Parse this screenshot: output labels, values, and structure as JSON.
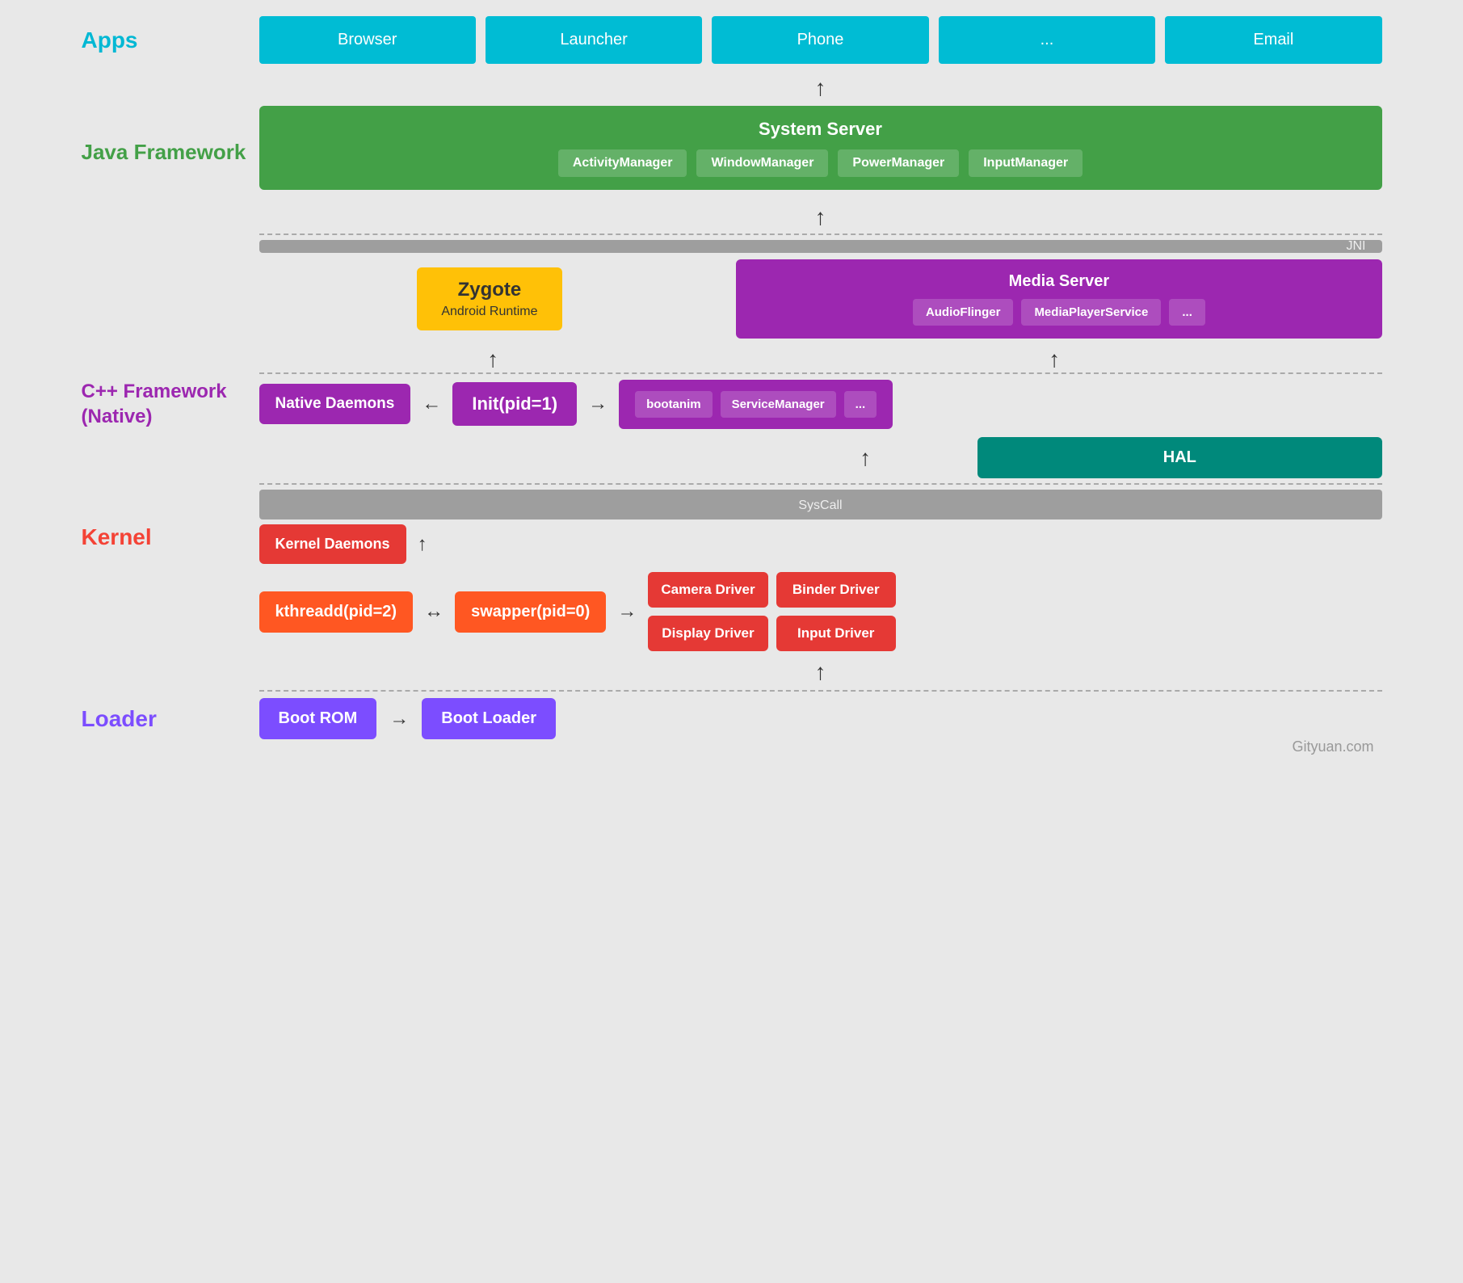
{
  "layers": {
    "apps": {
      "label": "Apps",
      "items": [
        "Browser",
        "Launcher",
        "Phone",
        "...",
        "Email"
      ]
    },
    "java_framework": {
      "label": "Java Framework",
      "system_server": {
        "title": "System Server",
        "items": [
          "ActivityManager",
          "WindowManager",
          "PowerManager",
          "InputManager"
        ]
      }
    },
    "jni_bar": "JNI",
    "zygote": {
      "title": "Zygote",
      "subtitle": "Android Runtime"
    },
    "cpp_framework": {
      "label": "C++ Framework\n(Native)",
      "media_server": {
        "title": "Media Server",
        "items": [
          "AudioFlinger",
          "MediaPlayerService",
          "..."
        ]
      },
      "init": "Init(pid=1)",
      "native_daemons": "Native Daemons",
      "services": [
        "bootanim",
        "ServiceManager",
        "..."
      ],
      "hal": "HAL"
    },
    "syscall_bar": "SysCall",
    "kernel": {
      "label": "Kernel",
      "kernel_daemons": "Kernel Daemons",
      "kthreadd": "kthreadd(pid=2)",
      "swapper": "swapper(pid=0)",
      "drivers": [
        "Camera Driver",
        "Binder Driver",
        "Display Driver",
        "Input Driver"
      ]
    },
    "loader": {
      "label": "Loader",
      "boot_rom": "Boot ROM",
      "boot_loader": "Boot Loader"
    }
  },
  "watermark": "Gityuan.com",
  "arrows": {
    "left": "←",
    "right": "→",
    "up": "↑",
    "both": "↔"
  }
}
